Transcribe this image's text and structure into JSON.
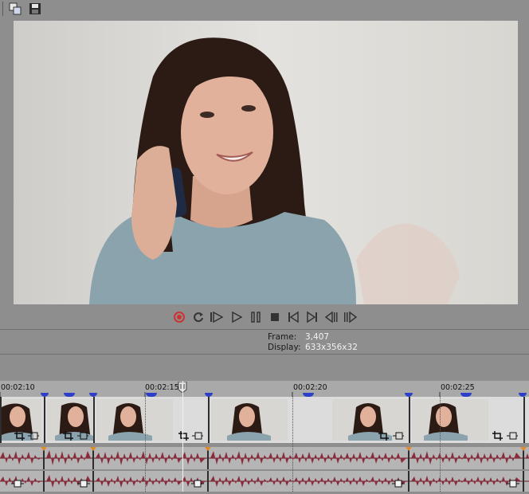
{
  "toolbar": {
    "buttons": [
      {
        "name": "copy-snapshot-icon"
      },
      {
        "name": "save-snapshot-icon"
      }
    ]
  },
  "transport": {
    "buttons": [
      "record-icon",
      "loop-icon",
      "play-from-start-icon",
      "play-icon",
      "pause-icon",
      "stop-icon",
      "previous-frame-marker-icon",
      "next-frame-marker-icon",
      "previous-frame-icon",
      "next-frame-icon"
    ]
  },
  "info": {
    "frame_label": "Frame:",
    "frame_value": "3,407",
    "display_label": "Display:",
    "display_value": "633x356x32"
  },
  "ruler": {
    "ticks": [
      "00:02:10",
      "00:02:15",
      "00:02:20",
      "00:02:25"
    ]
  },
  "colors": {
    "waveform": "#8a2a3a",
    "marker": "#2c3fc9",
    "fade_marker": "#e08a2a"
  }
}
